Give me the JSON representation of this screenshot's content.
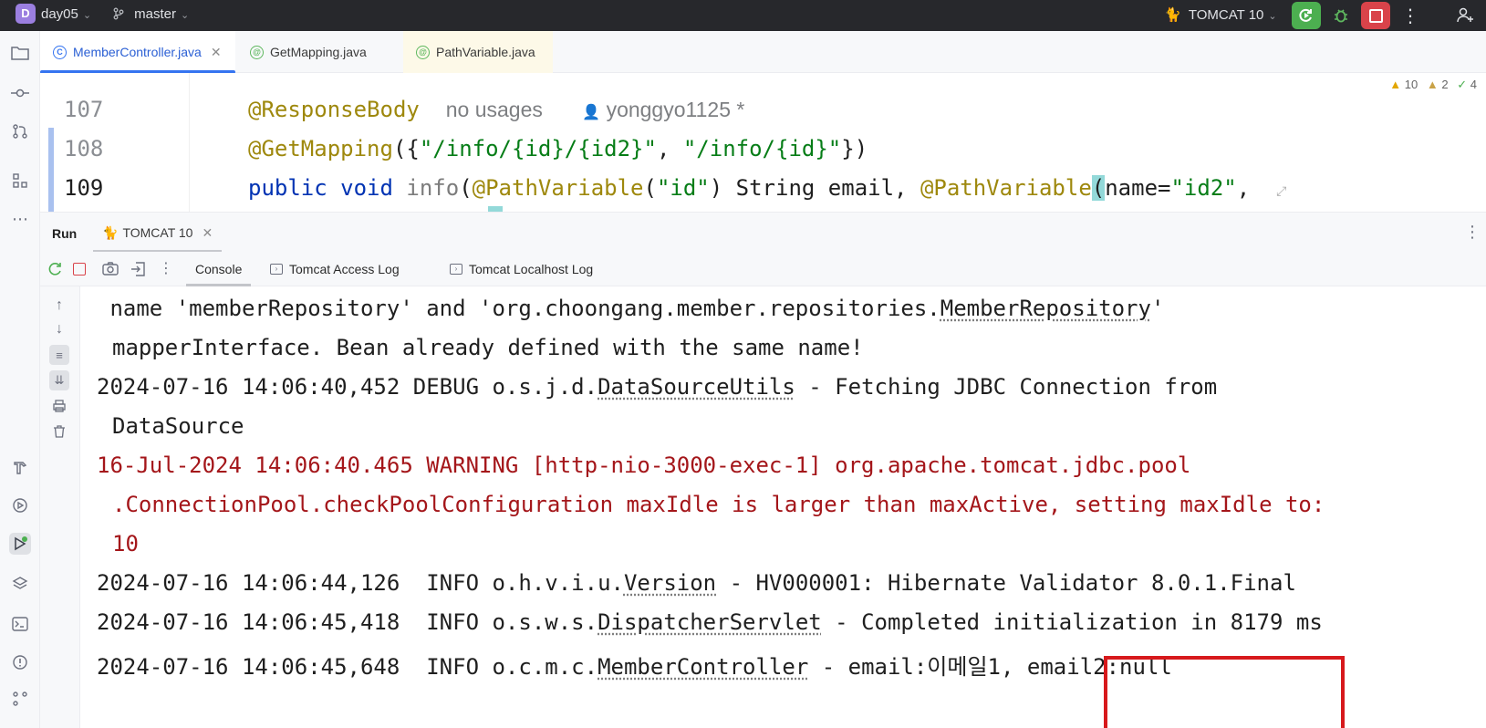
{
  "titlebar": {
    "project_initial": "D",
    "project": "day05",
    "branch": "master",
    "run_config": "TOMCAT 10"
  },
  "tabs": [
    {
      "label": "MemberController.java",
      "active": true
    },
    {
      "label": "GetMapping.java",
      "active": false
    },
    {
      "label": "PathVariable.java",
      "active": false
    }
  ],
  "inspections": {
    "warnings": "10",
    "weak_warnings": "2",
    "typos": "4"
  },
  "editor": {
    "lines": [
      {
        "number": "107"
      },
      {
        "number": "108"
      },
      {
        "number": "109"
      }
    ],
    "line107": {
      "annotation": "@ResponseBody",
      "usages_hint": "no usages",
      "author_hint": "yonggyo1125 *"
    },
    "line108": {
      "annotation": "@GetMapping",
      "open": "({",
      "s1": "\"/info/{id}/{id2}\"",
      "comma": ", ",
      "s2": "\"/info/{id}\"",
      "close": "})"
    },
    "line109": {
      "kw1": "public",
      "kw2": "void",
      "method": "info",
      "p1_anno": "@PathVariable",
      "p1_open": "(",
      "p1_str": "\"id\"",
      "p1_rest": ") String email, ",
      "p2_anno": "@PathVariable",
      "p2_paren": "(",
      "p2_name": "name=",
      "p2_str": "\"id2\"",
      "p2_tail": ","
    }
  },
  "run_panel": {
    "title": "Run",
    "config_tab": "TOMCAT 10",
    "console_tabs": [
      "Console",
      "Tomcat Access Log",
      "Tomcat Localhost Log"
    ]
  },
  "console": {
    "l1a": " name 'memberRepository' and 'org.choongang.member.repositories.",
    "l1b": "MemberRepository",
    "l1c": "'",
    "l2": "mapperInterface. Bean already defined with the same name!",
    "l3a": "2024-07-16 14:06:40,452 DEBUG o.s.j.d.",
    "l3b": "DataSourceUtils",
    "l3c": " - Fetching JDBC Connection from",
    "l4": "DataSource",
    "l5": "16-Jul-2024 14:06:40.465 WARNING [http-nio-3000-exec-1] org.apache.tomcat.jdbc.pool",
    "l6": ".ConnectionPool.checkPoolConfiguration maxIdle is larger than maxActive, setting maxIdle to:",
    "l7": "10",
    "l8a": "2024-07-16 14:06:44,126  INFO o.h.v.i.u.",
    "l8b": "Version",
    "l8c": " - HV000001: Hibernate Validator 8.0.1.Final",
    "l9a": "2024-07-16 14:06:45,418  INFO o.s.w.s.",
    "l9b": "DispatcherServlet",
    "l9c": " - Completed initialization in 8179 ms",
    "l10a": "2024-07-16 14:06:45,648  INFO o.c.m.c.",
    "l10b": "MemberController",
    "l10c": " - email:이메일1, email2:null"
  },
  "colors": {
    "accent": "#3574f0",
    "highlight_box": "#d7191c",
    "warning_text": "#a4161a"
  }
}
